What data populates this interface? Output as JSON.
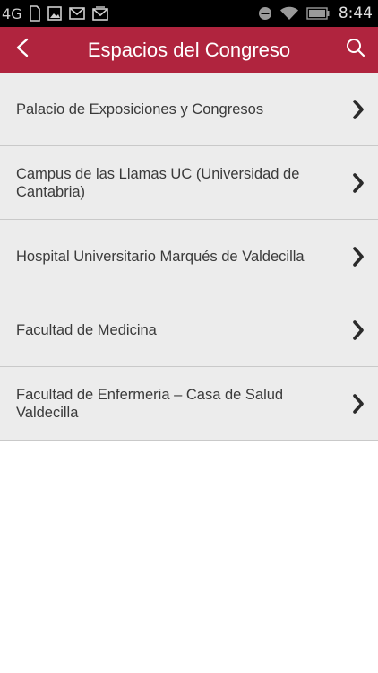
{
  "status_bar": {
    "network": "4G",
    "time": "8:44",
    "icons": [
      "signal-icon",
      "sim-card-icon",
      "image-icon",
      "gmail-icon",
      "gmail-icon",
      "do-not-disturb-icon",
      "wifi-icon",
      "battery-icon"
    ]
  },
  "app_bar": {
    "title": "Espacios del Congreso",
    "back_icon": "back-arrow-icon",
    "search_icon": "search-icon",
    "color": "#b0243e"
  },
  "venues": [
    {
      "label": "Palacio de Exposiciones y Congresos"
    },
    {
      "label": "Campus de las Llamas UC (Universidad de Cantabria)"
    },
    {
      "label": "Hospital Universitario Marqués de Valdecilla"
    },
    {
      "label": "Facultad de Medicina"
    },
    {
      "label": "Facultad de Enfermeria – Casa de Salud Valdecilla"
    }
  ]
}
